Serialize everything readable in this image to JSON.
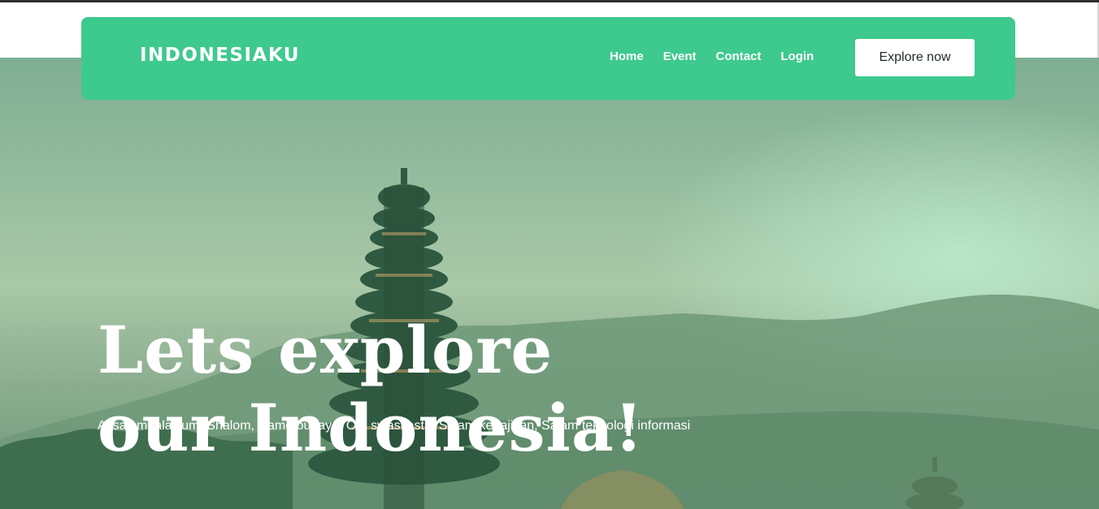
{
  "brand": {
    "logo_text": "INDONESIAKU"
  },
  "nav": {
    "links": [
      {
        "label": "Home"
      },
      {
        "label": "Event"
      },
      {
        "label": "Contact"
      },
      {
        "label": "Login"
      }
    ],
    "cta_label": "Explore now"
  },
  "hero": {
    "headline_line1": "Lets explore",
    "headline_line2": "our Indonesia!",
    "subtitle": "Assalamualaikum, Shalom, Namo budaya, Om swastiastu, Salam kebajikan, Salam teknologi informasi",
    "background_image": "bali-temple-pagoda-mountains"
  },
  "colors": {
    "accent": "#3ec98e",
    "text_light": "#ffffff",
    "button_bg": "#ffffff"
  }
}
